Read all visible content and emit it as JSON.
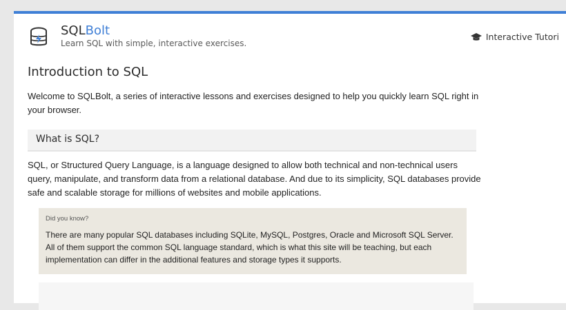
{
  "brand": {
    "name_prefix": "SQL",
    "name_accent": "Bolt",
    "tagline": "Learn SQL with simple, interactive exercises."
  },
  "nav": {
    "link_label": "Interactive Tutori"
  },
  "page": {
    "title": "Introduction to SQL",
    "intro": "Welcome to SQLBolt, a series of interactive lessons and exercises designed to help you quickly learn SQL right in your browser.",
    "section_title": "What is SQL?",
    "body": "SQL, or Structured Query Language, is a language designed to allow both technical and non-technical users query, manipulate, and transform data from a relational database. And due to its simplicity, SQL databases provide safe and scalable storage for millions of websites and mobile applications.",
    "callout_label": "Did you know?",
    "callout_text": "There are many popular SQL databases including SQLite, MySQL, Postgres, Oracle and Microsoft SQL Server. All of them support the common SQL language standard, which is what this site will be teaching, but each implementation can differ in the additional features and storage types it supports."
  },
  "icons": {
    "logo": "database-bolt-icon",
    "nav": "graduation-cap-icon"
  },
  "colors": {
    "accent": "#3f7fd6",
    "callout_bg": "#ebe8e0"
  }
}
